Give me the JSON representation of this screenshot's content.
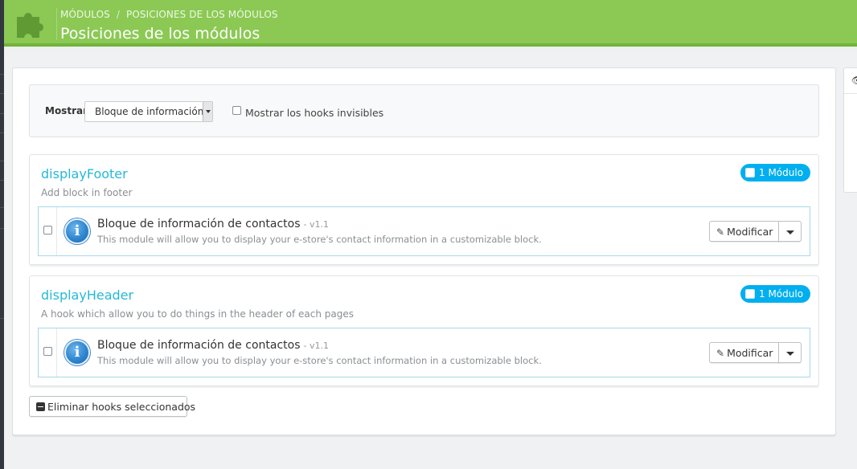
{
  "breadcrumb": {
    "item1": "MÓDULOS",
    "separator": "/",
    "item2": "POSICIONES DE LOS MÓDULOS"
  },
  "page": {
    "title": "Posiciones de los módulos"
  },
  "filter": {
    "show_label": "Mostrar",
    "select_value": "Bloque de información",
    "invisible_hooks_label": "Mostrar los hooks invisibles"
  },
  "hooks": [
    {
      "name": "displayFooter",
      "description": "Add block in footer",
      "badge": "1 Módulo",
      "module": {
        "name": "Bloque de información de contactos",
        "version": "- v1.1",
        "description": "This module will allow you to display your e-store's contact information in a customizable block.",
        "edit_label": "Modificar"
      }
    },
    {
      "name": "displayHeader",
      "description": "A hook which allow you to do things in the header of each pages",
      "badge": "1 Módulo",
      "module": {
        "name": "Bloque de información de contactos",
        "version": "- v1.1",
        "description": "This module will allow you to display your e-store's contact information in a customizable block.",
        "edit_label": "Modificar"
      }
    }
  ],
  "actions": {
    "delete_selected_label": "Eliminar hooks seleccionados"
  },
  "colors": {
    "header_green": "#8bc954",
    "link_blue": "#25b9d7",
    "badge_blue": "#00aff0"
  },
  "icons": {
    "header": "puzzle-icon",
    "module": "info-icon",
    "edit": "pencil-icon",
    "delete": "minus-square-icon",
    "side": "eye-icon"
  }
}
